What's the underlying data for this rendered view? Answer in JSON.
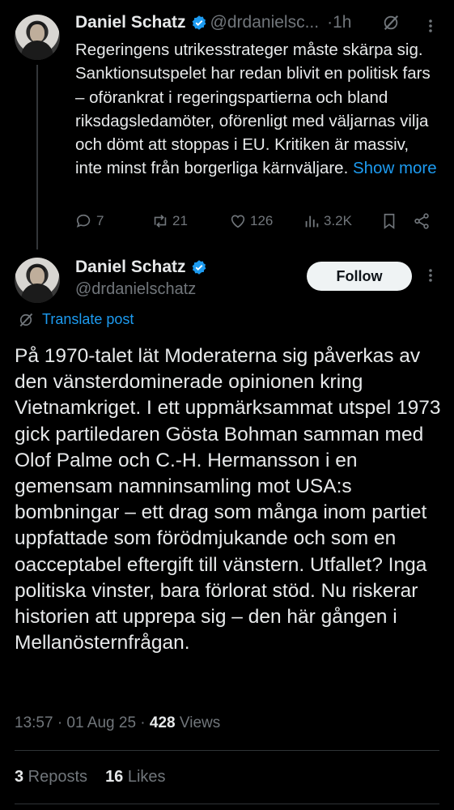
{
  "tweet1": {
    "author_name": "Daniel Schatz",
    "handle": "@drdanielsc...",
    "sep": "·",
    "time": "1h",
    "body": "Regeringens utrikesstrateger måste skärpa sig. Sanktionsutspelet har redan blivit en politisk fars – oförankrat i regeringspartierna och bland riksdagsledamöter, oförenligt med väljarnas vilja och dömt att stoppas i EU. Kritiken är massiv, inte minst från borgerliga kärnväljare. ",
    "show_more": "Show more",
    "replies": "7",
    "reposts": "21",
    "likes": "126",
    "views": "3.2K"
  },
  "tweet2": {
    "author_name": "Daniel Schatz",
    "handle": "@drdanielschatz",
    "follow_label": "Follow",
    "translate_label": "Translate post",
    "body": "På 1970-talet lät Moderaterna sig påverkas av den vänsterdominerade opinionen kring Vietnamkriget. I ett uppmärksammat utspel 1973 gick partiledaren Gösta Bohman samman med Olof Palme och C.-H. Hermansson i en gemensam namninsamling mot USA:s bombningar – ett drag som många inom partiet uppfattade som förödmjukande och som en oacceptabel eftergift till vänstern. Utfallet? Inga politiska vinster, bara förlorat stöd. Nu riskerar historien att upprepa sig – den här gången i Mellanösternfrågan.",
    "timestamp": "13:57 · 01 Aug 25 · ",
    "views_count": "428",
    "views_label": " Views",
    "reposts_count": "3",
    "reposts_label": " Reposts",
    "likes_count": "16",
    "likes_label": " Likes"
  },
  "colors": {
    "background": "#000000",
    "text": "#e7e9ea",
    "muted": "#71767b",
    "accent": "#1d9bf0",
    "divider": "#2f3336"
  },
  "icons": [
    "verified-badge-icon",
    "grok-icon",
    "more-icon",
    "reply-icon",
    "repost-icon",
    "like-icon",
    "views-icon",
    "bookmark-icon",
    "share-icon",
    "translate-icon"
  ]
}
